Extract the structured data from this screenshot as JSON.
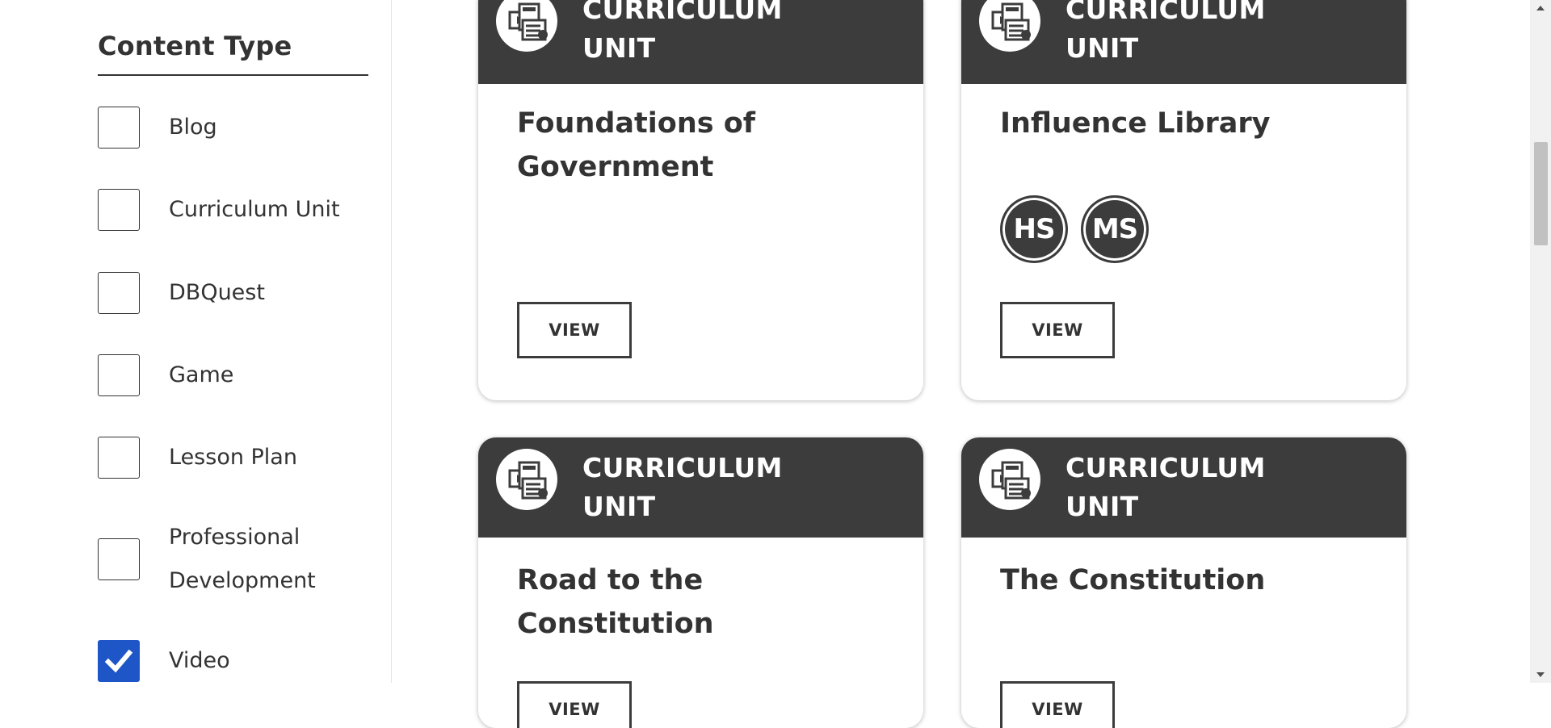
{
  "sidebar": {
    "title": "Content Type",
    "filters": [
      {
        "label": "Blog",
        "checked": false
      },
      {
        "label": "Curriculum Unit",
        "checked": false
      },
      {
        "label": "DBQuest",
        "checked": false
      },
      {
        "label": "Game",
        "checked": false
      },
      {
        "label": "Lesson Plan",
        "checked": false
      },
      {
        "label": "Professional Development",
        "checked": false
      },
      {
        "label": "Video",
        "checked": true
      }
    ]
  },
  "cards": [
    {
      "type": "CURRICULUM UNIT",
      "title": "Foundations of Government",
      "badges": [],
      "button": "VIEW",
      "icon": "curriculum-unit-icon"
    },
    {
      "type": "CURRICULUM UNIT",
      "title": "Influence Library",
      "badges": [
        "HS",
        "MS"
      ],
      "button": "VIEW",
      "icon": "curriculum-unit-icon"
    },
    {
      "type": "CURRICULUM UNIT",
      "title": "Road to the Constitution",
      "badges": [],
      "button": "VIEW",
      "icon": "curriculum-unit-icon"
    },
    {
      "type": "CURRICULUM UNIT",
      "title": "The Constitution",
      "badges": [],
      "button": "VIEW",
      "icon": "curriculum-unit-icon"
    }
  ],
  "colors": {
    "card_header": "#3c3c3c",
    "checkbox_checked": "#1e56c8",
    "text": "#333333"
  }
}
